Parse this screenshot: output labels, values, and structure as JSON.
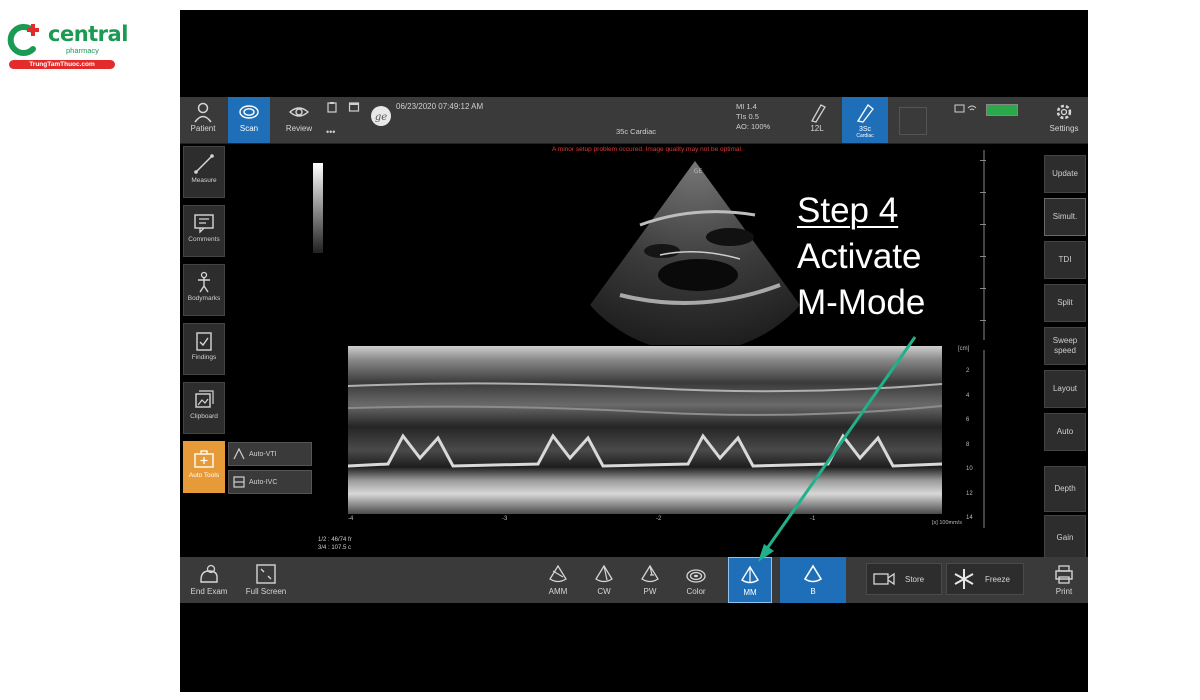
{
  "logo": {
    "name": "central",
    "sub": "pharmacy",
    "url": "TrungTamThuoc.com"
  },
  "topbar": {
    "patient": "Patient",
    "scan": "Scan",
    "review": "Review",
    "more": "•••",
    "datetime": "06/23/2020 07:49:12 AM",
    "probe_preset": "35c   Cardiac",
    "mi": "MI 1.4",
    "tis": "TIs 0.5",
    "ao": "AO: 100%",
    "probe_12l": "12L",
    "probe_3sc": "3Sc",
    "probe_3sc_sub": "Cardiac",
    "settings": "Settings"
  },
  "warning": "A minor setup problem occured. Image quality may not be optimal.",
  "left_tools": [
    {
      "label": "Measure"
    },
    {
      "label": "Comments"
    },
    {
      "label": "Bodymarks"
    },
    {
      "label": "Findings"
    },
    {
      "label": "Clipboard"
    },
    {
      "label": "Auto Tools"
    }
  ],
  "auto_buttons": {
    "vti": "Auto-VTI",
    "ivc": "Auto-IVC"
  },
  "right_tools": [
    {
      "label": "Update"
    },
    {
      "label": "Simult."
    },
    {
      "label": "TDI"
    },
    {
      "label": "Split"
    },
    {
      "label": "Sweep speed"
    },
    {
      "label": "Layout"
    },
    {
      "label": "Auto"
    },
    {
      "label": "Depth"
    },
    {
      "label": "Gain"
    }
  ],
  "step": {
    "line1": "Step 4",
    "line2": "Activate",
    "line3": "M-Mode"
  },
  "depth_unit": "[cm]",
  "depth_ticks": [
    "2",
    "4",
    "6",
    "8",
    "10",
    "12",
    "14"
  ],
  "time_ticks": [
    "-4",
    "-3",
    "-2",
    "-1"
  ],
  "time_unit": "[s] 100mm/s",
  "measurements": {
    "line1": "1/2 : 46/74 fr",
    "line2": "3/4 : 107.5 c"
  },
  "bottombar": {
    "end_exam": "End Exam",
    "full_screen": "Full Screen",
    "amm": "AMM",
    "cw": "CW",
    "pw": "PW",
    "color": "Color",
    "mm": "MM",
    "b": "B",
    "store": "Store",
    "freeze": "Freeze",
    "print": "Print"
  }
}
